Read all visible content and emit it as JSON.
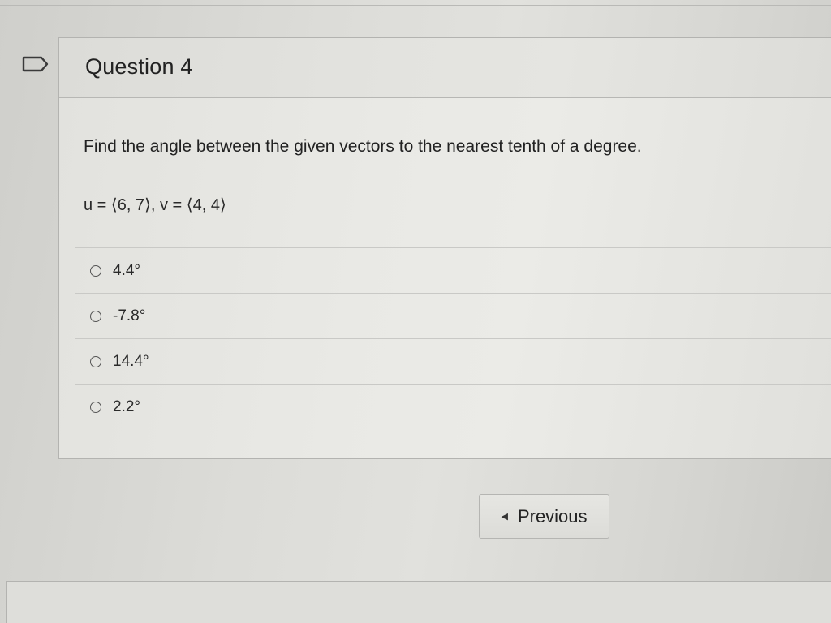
{
  "question": {
    "title": "Question 4",
    "prompt": "Find the angle between the given vectors to the nearest tenth of a degree.",
    "vectors": "u = ⟨6, 7⟩, v = ⟨4, 4⟩",
    "choices": [
      {
        "label": "4.4°"
      },
      {
        "label": "-7.8°"
      },
      {
        "label": "14.4°"
      },
      {
        "label": "2.2°"
      }
    ]
  },
  "navigation": {
    "previous_label": "Previous"
  },
  "icons": {
    "bookmark": "bookmark-flag-icon",
    "previous": "caret-left-icon",
    "radio": "radio-unchecked-icon"
  }
}
